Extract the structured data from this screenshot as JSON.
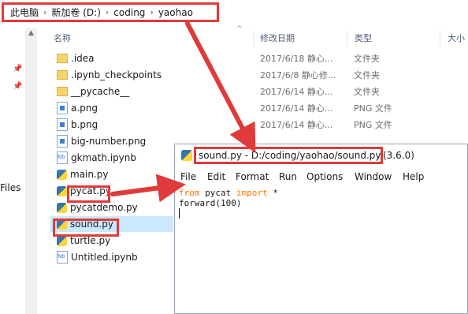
{
  "breadcrumb": {
    "items": [
      "此电脑",
      "新加卷 (D:)",
      "coding",
      "yaohao"
    ],
    "sep": "›"
  },
  "nav": {
    "files_label": "Files"
  },
  "columns": {
    "name": "名称",
    "modified": "修改日期",
    "type": "类型",
    "size": "大小"
  },
  "files": [
    {
      "name": ".idea",
      "icon": "folder-icon",
      "date": "2017/6/18 静心...",
      "type": "文件夹"
    },
    {
      "name": ".ipynb_checkpoints",
      "icon": "folder-icon",
      "date": "2017/6/8 静心修...",
      "type": "文件夹"
    },
    {
      "name": "__pycache__",
      "icon": "folder-icon",
      "date": "2017/6/14 静心...",
      "type": "文件夹"
    },
    {
      "name": "a.png",
      "icon": "png-file-icon",
      "date": "2017/6/14 静心...",
      "type": "PNG 文件"
    },
    {
      "name": "b.png",
      "icon": "png-file-icon",
      "date": "2017/6/14 静心...",
      "type": "PNG 文件"
    },
    {
      "name": "big-number.png",
      "icon": "png-file-icon",
      "date": "",
      "type": ""
    },
    {
      "name": "gkmath.ipynb",
      "icon": "notebook-file-icon",
      "date": "",
      "type": ""
    },
    {
      "name": "main.py",
      "icon": "python-file-icon",
      "date": "",
      "type": ""
    },
    {
      "name": "pycat.py",
      "icon": "python-file-icon",
      "date": "",
      "type": ""
    },
    {
      "name": "pycatdemo.py",
      "icon": "python-file-icon",
      "date": "",
      "type": ""
    },
    {
      "name": "sound.py",
      "icon": "python-file-icon",
      "date": "",
      "type": ""
    },
    {
      "name": "turtle.py",
      "icon": "python-file-icon",
      "date": "",
      "type": ""
    },
    {
      "name": "Untitled.ipynb",
      "icon": "notebook-file-icon",
      "date": "",
      "type": ""
    }
  ],
  "idle": {
    "title": "sound.py - D:/coding/yaohao/sound.py",
    "version": "(3.6.0)",
    "menu": [
      "File",
      "Edit",
      "Format",
      "Run",
      "Options",
      "Window",
      "Help"
    ],
    "code": {
      "line1_kw1": "from",
      "line1_mod": " pycat ",
      "line1_kw2": "import",
      "line1_rest": " *",
      "line2": "forward(100)"
    }
  },
  "colors": {
    "highlight": "#e03a3a",
    "selection": "#cce8ff",
    "keyword": "#ff7700"
  }
}
